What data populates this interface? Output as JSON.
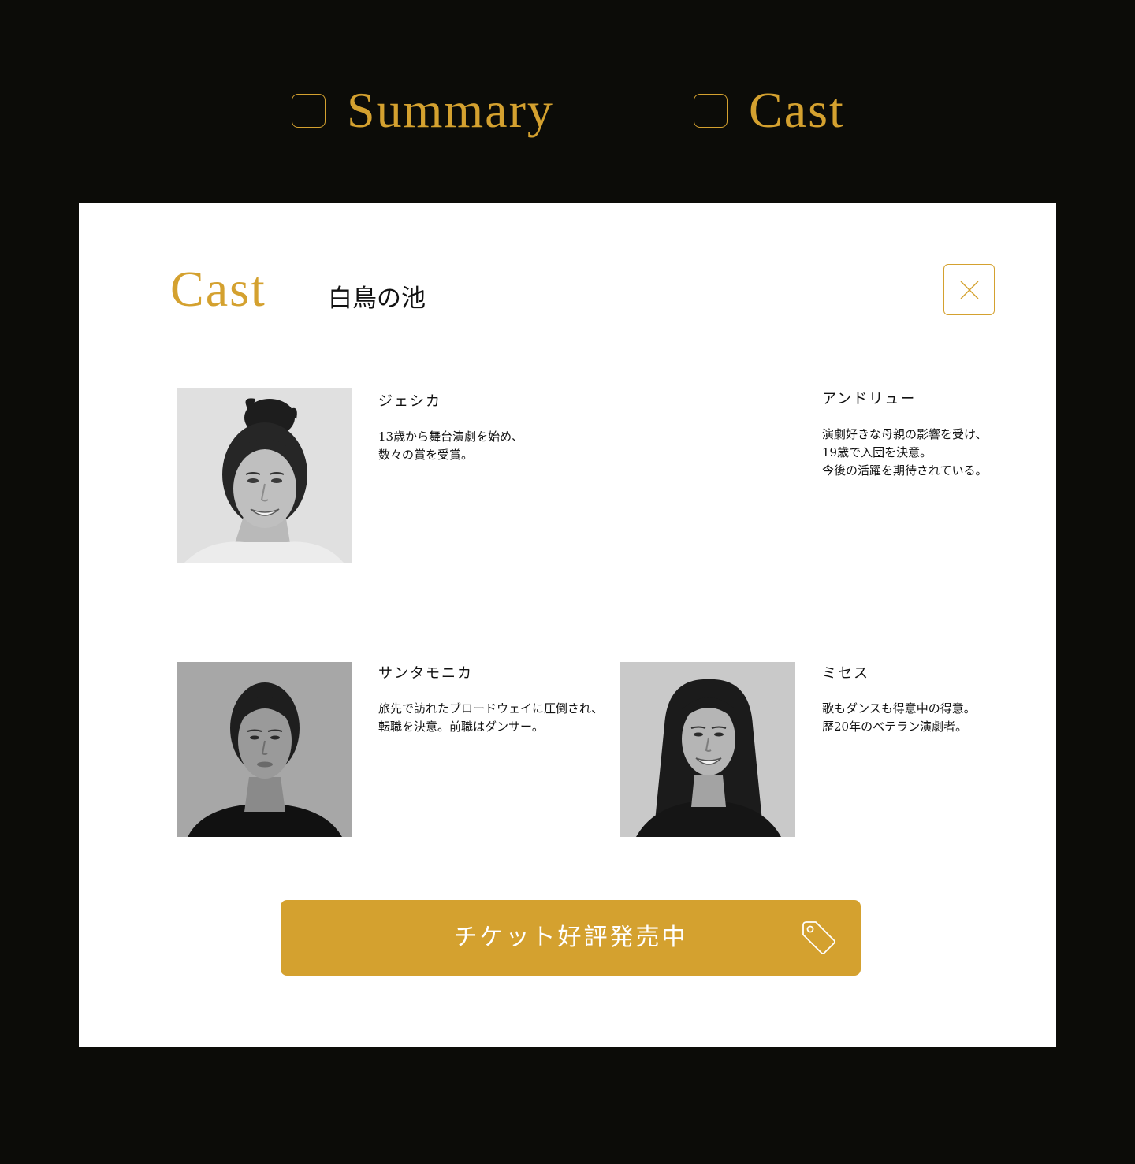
{
  "tabs": [
    {
      "label": "Summary"
    },
    {
      "label": "Cast"
    }
  ],
  "modal": {
    "title": "Cast",
    "subtitle": "白鳥の池",
    "close_icon": "close-icon"
  },
  "cast": [
    {
      "name": "ジェシカ",
      "description": "13歳から舞台演劇を始め、\n数々の賞を受賞。",
      "photo": "portrait-photo"
    },
    {
      "name": "アンドリュー",
      "description": "演劇好きな母親の影響を受け、\n19歳で入団を決意。\n今後の活躍を期待されている。",
      "photo": ""
    },
    {
      "name": "サンタモニカ",
      "description": "旅先で訪れたブロードウェイに圧倒され、\n転職を決意。前職はダンサー。",
      "photo": "portrait-photo"
    },
    {
      "name": "ミセス",
      "description": "歌もダンスも得意中の得意。\n歴20年のベテラン演劇者。",
      "photo": "portrait-photo"
    }
  ],
  "ticket_button": {
    "label": "チケット好評発売中",
    "icon": "price-tag-icon"
  },
  "colors": {
    "background": "#0c0c08",
    "accent": "#d4a12f",
    "panel": "#ffffff",
    "text": "#111111"
  }
}
